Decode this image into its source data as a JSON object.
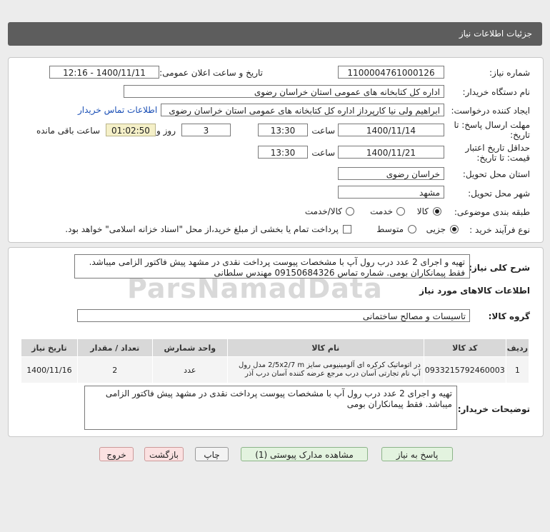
{
  "header": {
    "title": "جزئیات اطلاعات نیاز"
  },
  "form": {
    "need_number_label": "شماره نیاز:",
    "need_number": "1100004761000126",
    "announce_label": "تاریخ و ساعت اعلان عمومی:",
    "announce_value": "1400/11/11 - 12:16",
    "buyer_org_label": "نام دستگاه خریدار:",
    "buyer_org": "اداره کل کتابخانه های عمومی استان خراسان رضوی",
    "creator_label": "ایجاد کننده درخواست:",
    "creator": "ابراهیم ولی نیا کارپرداز اداره کل کتابخانه های عمومی استان خراسان رضوی",
    "contact_link": "اطلاعات تماس خریدار",
    "deadline_label_1": "مهلت ارسال پاسخ: تا",
    "deadline_label_2": "تاریخ:",
    "deadline_date": "1400/11/14",
    "time_label": "ساعت",
    "deadline_time": "13:30",
    "days_value": "3",
    "days_label": "روز و",
    "timer_value": "01:02:50",
    "remaining_label": "ساعت باقی مانده",
    "validity_label_1": "حداقل تاریخ اعتبار",
    "validity_label_2": "قیمت: تا تاریخ:",
    "validity_date": "1400/11/21",
    "validity_time": "13:30",
    "province_label": "استان محل تحویل:",
    "province": "خراسان رضوی",
    "city_label": "شهر محل تحویل:",
    "city": "مشهد",
    "category_label": "طبقه بندی موضوعی:",
    "category_options": [
      "کالا",
      "خدمت",
      "کالا/خدمت"
    ],
    "process_label": "نوع فرآیند خرید :",
    "process_options": [
      "جزیی",
      "متوسط"
    ],
    "payment_note": "پرداخت تمام یا بخشی از مبلغ خرید،از محل \"اسناد خزانه اسلامی\" خواهد بود."
  },
  "details": {
    "summary_label": "شرح کلی نیاز:",
    "summary_line1": "تهیه و اجرای 2 عدد درب رول آپ با مشخصات پیوست پرداخت نقدی در مشهد پیش فاکتور الزامی میباشد.",
    "summary_line2": "فقط پیمانکاران بومی. شماره تماس 09150684326 مهندس سلطانی",
    "goods_info_title": "اطلاعات کالاهای مورد نیاز",
    "group_label": "گروه کالا:",
    "group_value": "تاسیسات و مصالح ساختمانی",
    "table": {
      "headers": [
        "ردیف",
        "کد کالا",
        "نام کالا",
        "واحد شمارش",
        "تعداد / مقدار",
        "تاریخ نیاز"
      ],
      "rows": [
        {
          "index": "1",
          "code": "0933215792460003",
          "name_line1": "در اتوماتیک کرکره ای آلومینیومی سایز 2/5x2/7 m مدل رول",
          "name_line2": "آپ نام تجارتی آسان درب مرجع عرضه کننده آسان درب آذر",
          "unit": "عدد",
          "qty": "2",
          "date": "1400/11/16"
        }
      ]
    },
    "buyer_notes_label": "توضیحات خریدار:",
    "buyer_notes_line1": "تهیه و اجرای 2 عدد درب رول آپ با مشخصات پیوست پرداخت نقدی در مشهد پیش فاکتور الزامی",
    "buyer_notes_line2": "میباشد. فقط پیمانکاران بومی"
  },
  "buttons": {
    "reply": "پاسخ به نیاز",
    "view_docs": "مشاهده مدارک پیوستی (1)",
    "print": "چاپ",
    "back": "بازگشت",
    "exit": "خروج"
  }
}
